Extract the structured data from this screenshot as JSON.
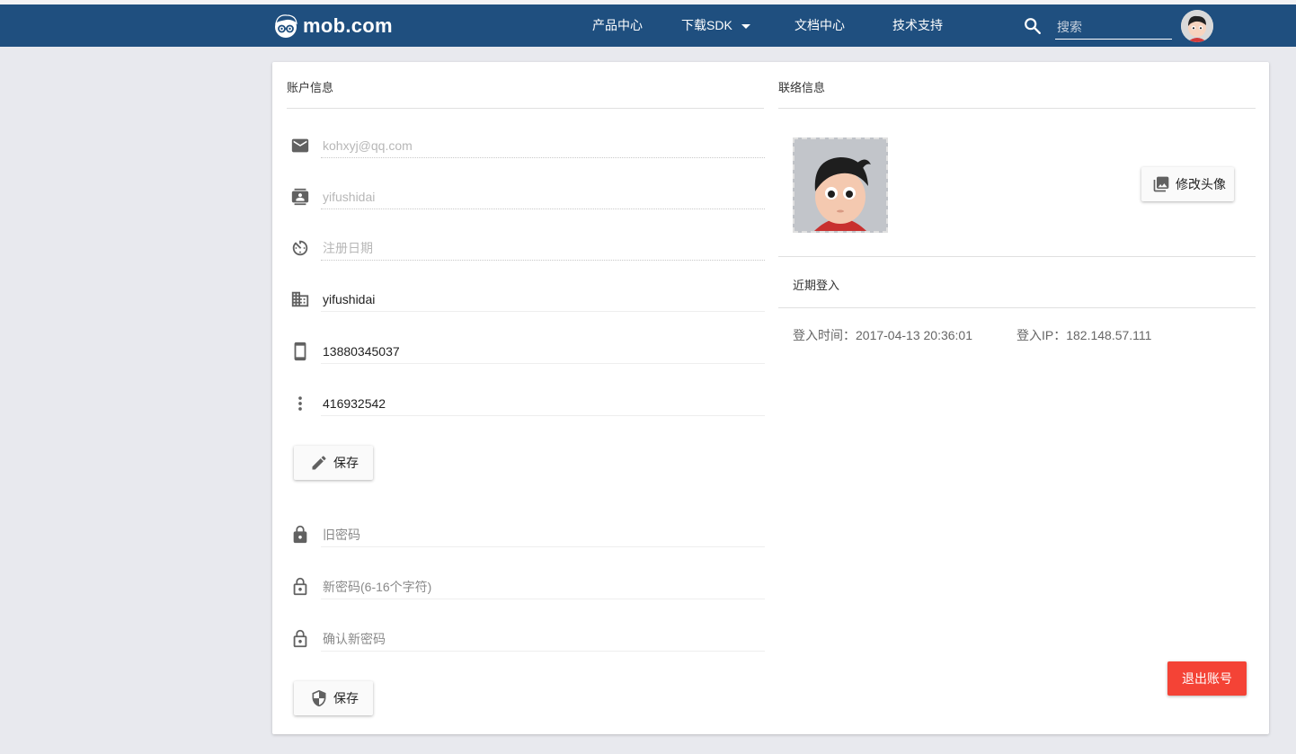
{
  "nav": {
    "logo_text": "mob.com",
    "items": [
      {
        "label": "产品中心"
      },
      {
        "label": "下载SDK"
      },
      {
        "label": "文档中心"
      },
      {
        "label": "技术支持"
      }
    ],
    "search_placeholder": "搜索"
  },
  "account": {
    "title": "账户信息",
    "email_placeholder": "kohxyj@qq.com",
    "username_placeholder": "yifushidai",
    "regdate_placeholder": "注册日期",
    "company_value": "yifushidai",
    "phone_value": "13880345037",
    "qq_value": "416932542",
    "save_label": "保存",
    "old_password_placeholder": "旧密码",
    "new_password_placeholder": "新密码(6-16个字符)",
    "confirm_password_placeholder": "确认新密码",
    "save_password_label": "保存"
  },
  "contact": {
    "title": "联络信息",
    "change_avatar_label": "修改头像",
    "recent_login_title": "近期登入",
    "login_time": "登入时间：2017-04-13 20:36:01",
    "login_ip": "登入IP：182.148.57.111",
    "logout_label": "退出账号"
  },
  "colors": {
    "navbar": "#1f4f7f",
    "background": "#e8e9ee",
    "logout": "#f44336",
    "icon": "#616161"
  }
}
